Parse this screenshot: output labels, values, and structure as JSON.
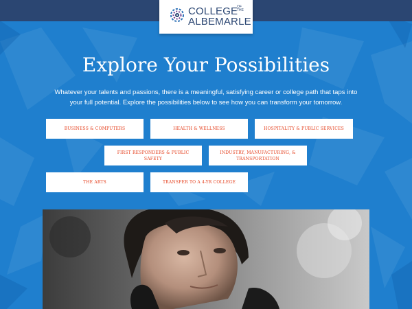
{
  "header": {
    "logo_line1": "COLLEGE",
    "logo_of_the": "OF THE",
    "logo_line2": "ALBEMARLE"
  },
  "hero": {
    "title": "Explore Your Possibilities",
    "intro": "Whatever your talents and passions, there is a meaningful, satisfying career or college path that taps into your full potential. Explore the possibilities below to see how you can transform your tomorrow."
  },
  "pathways": [
    {
      "label": "BUSINESS & COMPUTERS"
    },
    {
      "label": "HEALTH & WELLNESS"
    },
    {
      "label": "HOSPITALITY & PUBLIC SERVICES"
    },
    {
      "label": "FIRST RESPONDERS & PUBLIC SAFETY"
    },
    {
      "label": "INDUSTRY, MANUFACTURING, & TRANSPORTATION"
    },
    {
      "label": "THE ARTS"
    },
    {
      "label": "TRANSFER TO A 4-YR COLLEGE"
    }
  ],
  "colors": {
    "background": "#1f7fce",
    "topbar": "#2b4672",
    "button_text": "#e5411f"
  }
}
